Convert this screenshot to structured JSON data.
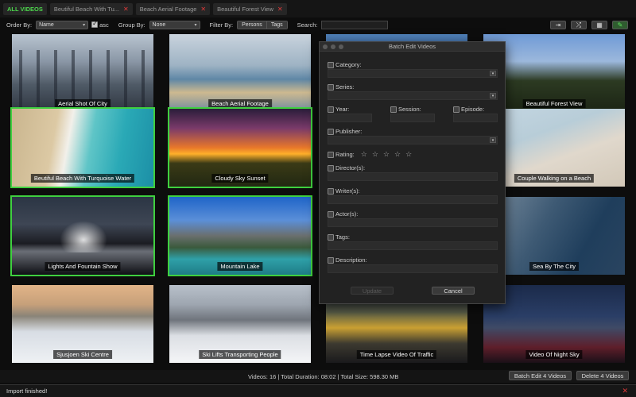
{
  "tabs": [
    {
      "label": "ALL VIDEOS",
      "active": true,
      "closable": false
    },
    {
      "label": "Beutiful Beach With Tu...",
      "active": false,
      "closable": true
    },
    {
      "label": "Beach Aerial Footage",
      "active": false,
      "closable": true
    },
    {
      "label": "Beautiful Forest View",
      "active": false,
      "closable": true
    }
  ],
  "toolbar": {
    "order_by_label": "Order By:",
    "order_by_value": "Name",
    "asc_label": "asc",
    "group_by_label": "Group By:",
    "group_by_value": "None",
    "filter_by_label": "Filter By:",
    "filter_persons": "Persons",
    "filter_tags": "Tags",
    "search_label": "Search:",
    "search_value": ""
  },
  "videos": [
    {
      "title": "Aerial Shot Of City",
      "selected": false
    },
    {
      "title": "Beach Aerial Footage",
      "selected": false
    },
    {
      "title": "",
      "selected": false
    },
    {
      "title": "Beautiful Forest View",
      "selected": false
    },
    {
      "title": "Beutiful Beach With Turquoise Water",
      "selected": true
    },
    {
      "title": "Cloudy Sky Sunset",
      "selected": true
    },
    {
      "title": "",
      "selected": false
    },
    {
      "title": "Couple Walking on a Beach",
      "selected": false
    },
    {
      "title": "Lights And Fountain Show",
      "selected": true
    },
    {
      "title": "Mountain Lake",
      "selected": true
    },
    {
      "title": "",
      "selected": false
    },
    {
      "title": "Sea By The City",
      "selected": false
    },
    {
      "title": "Sjusjoen Ski Centre",
      "selected": false
    },
    {
      "title": "Ski Lifts Transporting People",
      "selected": false
    },
    {
      "title": "Time Lapse Video Of Traffic",
      "selected": false
    },
    {
      "title": "Video Of Night Sky",
      "selected": false
    }
  ],
  "dialog": {
    "title": "Batch Edit Videos",
    "category_label": "Category:",
    "series_label": "Series:",
    "year_label": "Year:",
    "session_label": "Session:",
    "episode_label": "Episode:",
    "publisher_label": "Publisher:",
    "rating_label": "Rating:",
    "directors_label": "Director(s):",
    "writers_label": "Writer(s):",
    "actors_label": "Actor(s):",
    "tags_label": "Tags:",
    "description_label": "Description:",
    "update_label": "Update",
    "cancel_label": "Cancel",
    "stars": [
      "☆",
      "☆",
      "☆",
      "☆",
      "☆"
    ]
  },
  "footer": {
    "summary": "Videos:  16  |  Total Duration:  08:02  |  Total Size:  598.30 MB",
    "batch_edit_label": "Batch Edit 4 Videos",
    "delete_label": "Delete 4 Videos"
  },
  "status": {
    "message": "Import finished!"
  },
  "colors": {
    "accent_green": "#3fd03f",
    "close_red": "#e03a3a"
  }
}
